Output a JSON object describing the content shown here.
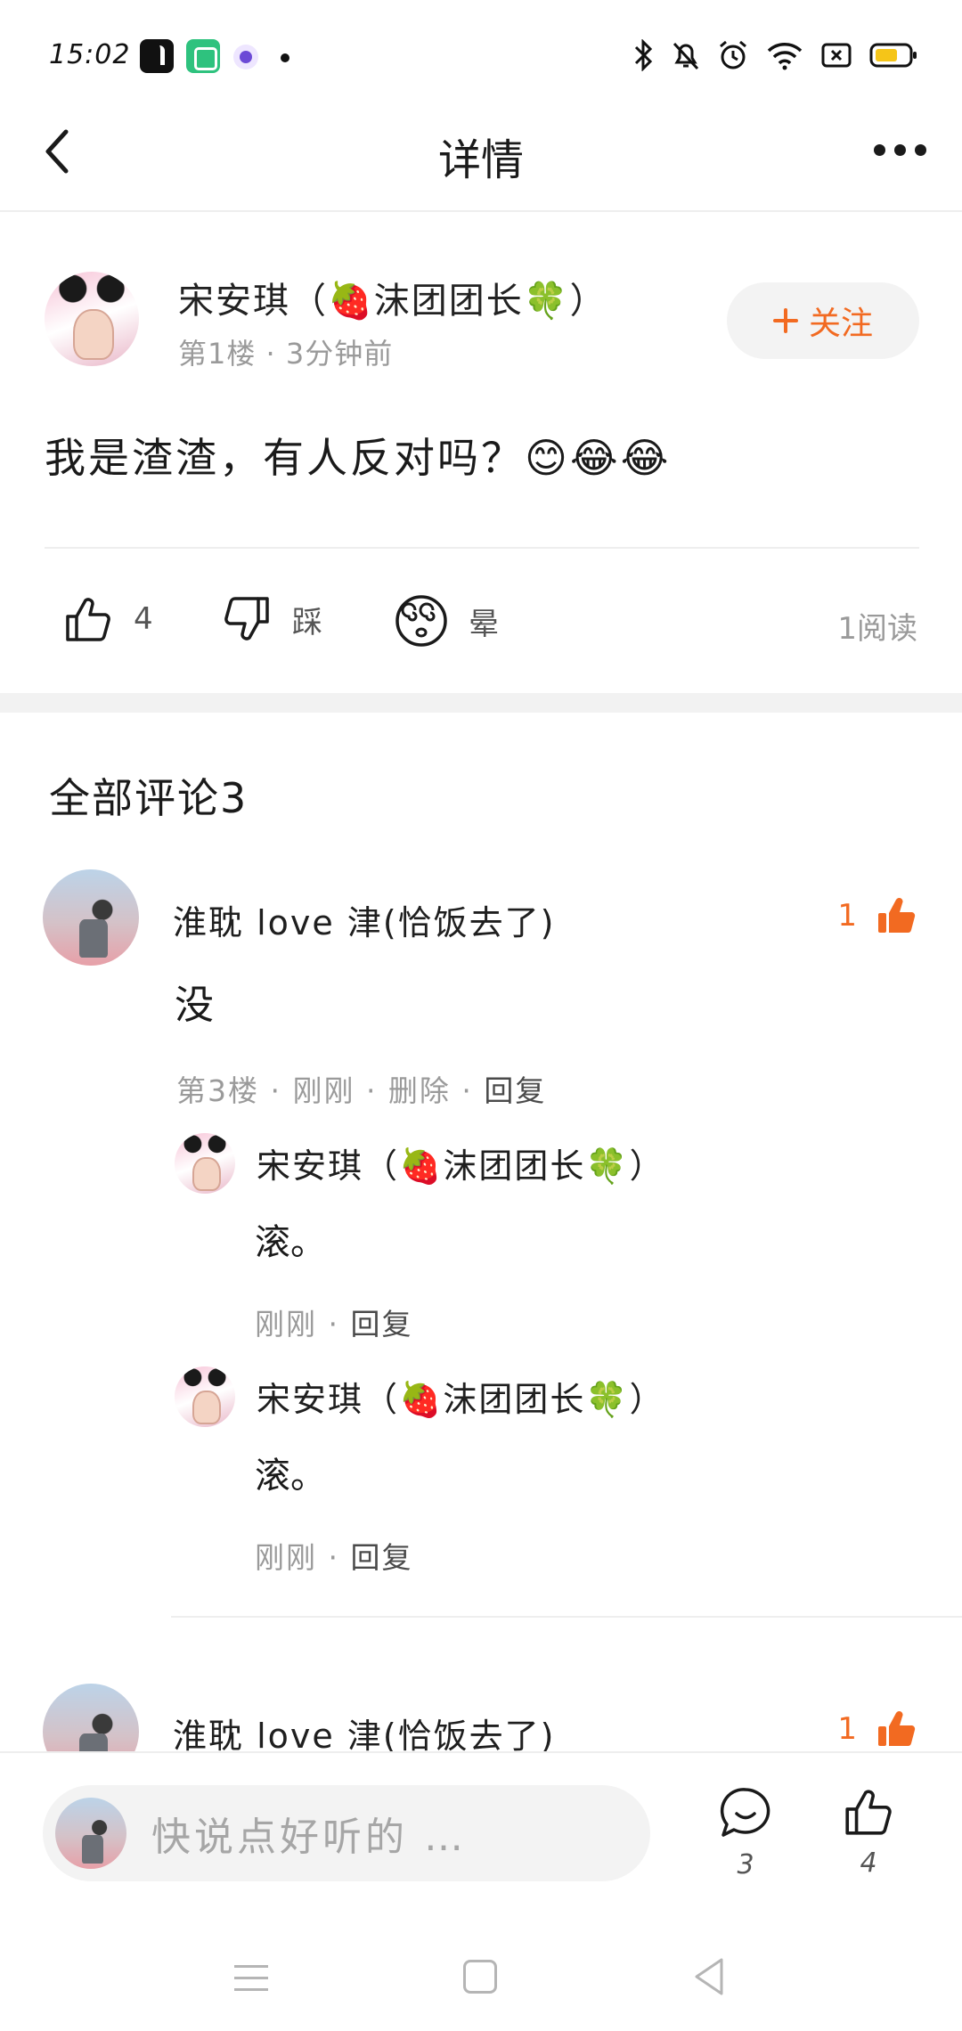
{
  "status_bar": {
    "time": "15:02",
    "icons": [
      "tiktok-app-icon",
      "green-app-icon",
      "purple-app-icon",
      "notification-dot",
      "bluetooth-icon",
      "mute-icon",
      "alarm-icon",
      "wifi-icon",
      "sim-icon",
      "battery-icon"
    ],
    "battery_color": "#f5c518"
  },
  "header": {
    "title": "详情",
    "back_icon": "chevron-left-icon",
    "more_icon": "more-dots-icon"
  },
  "post": {
    "author": "宋安琪（🍓沫团团长🍀）",
    "meta": "第1楼 · 3分钟前",
    "follow_label": "关注",
    "content": "我是渣渣，有人反对吗？😊😂😂",
    "actions": {
      "like_count": "4",
      "dislike_label": "踩",
      "dizzy_label": "晕"
    },
    "read_count": "1阅读"
  },
  "comments": {
    "title": "全部评论3",
    "items": [
      {
        "author": "淮耽 love 津(恰饭去了)",
        "like_count": "1",
        "text": "没",
        "meta_prefix": "第3楼 · 刚刚 · 删除 · ",
        "reply_label": "回复",
        "replies": [
          {
            "author": "宋安琪（🍓沫团团长🍀）",
            "text": "滚。",
            "meta_prefix": "刚刚 · ",
            "reply_label": "回复"
          },
          {
            "author": "宋安琪（🍓沫团团长🍀）",
            "text": "滚。",
            "meta_prefix": "刚刚 · ",
            "reply_label": "回复"
          }
        ]
      },
      {
        "author": "淮耽 love 津(恰饭去了)",
        "like_count": "1"
      }
    ]
  },
  "bottom_bar": {
    "input_placeholder": "快说点好听的 …",
    "comment_count": "3",
    "like_count": "4"
  },
  "colors": {
    "accent": "#f26a21",
    "muted_text": "#9a9a9a",
    "divider": "#eeeeee",
    "section_gap": "#f2f2f2"
  }
}
